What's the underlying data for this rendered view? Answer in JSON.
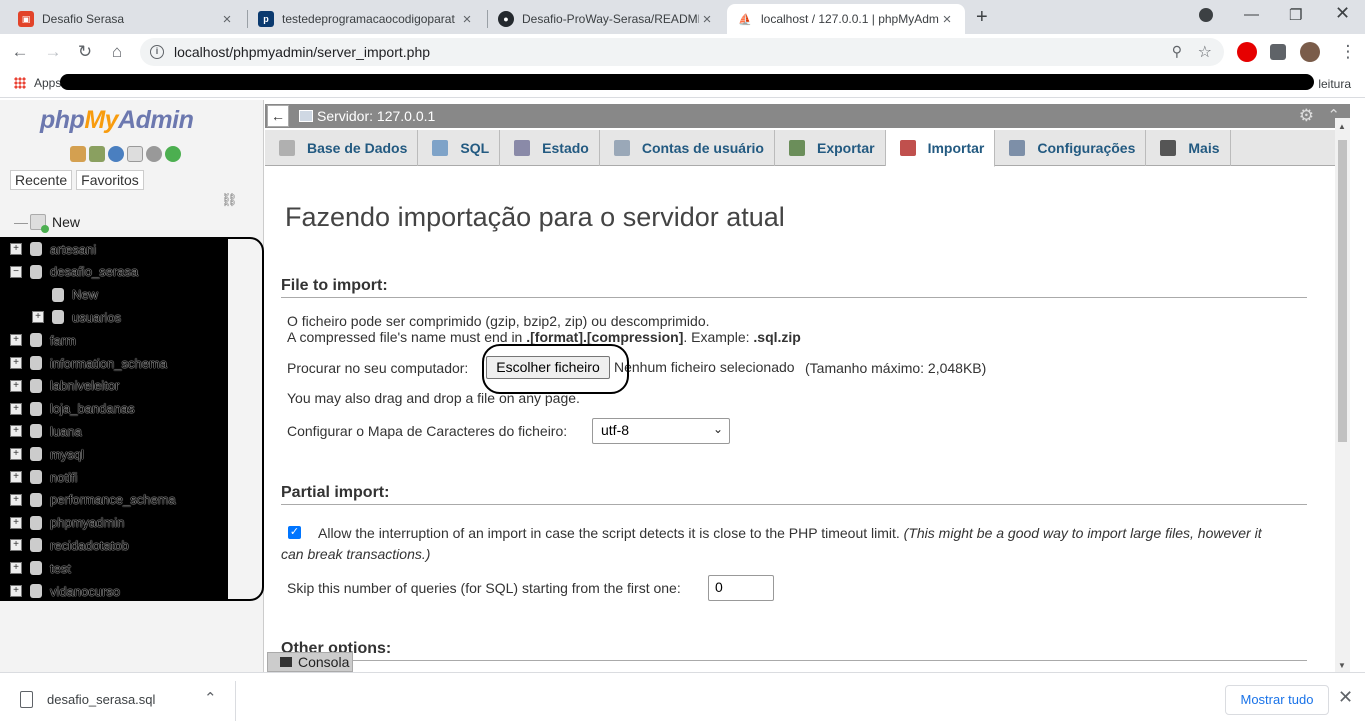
{
  "browser": {
    "tabs": [
      {
        "title": "Desafio Serasa",
        "icon": "gitlab-icon",
        "color": "#e24329"
      },
      {
        "title": "testedeprogramacaocodigoparat",
        "icon": "proway-icon",
        "color": "#0b3a6f"
      },
      {
        "title": "Desafio-ProWay-Serasa/README",
        "icon": "github-icon",
        "color": "#24292e"
      },
      {
        "title": "localhost / 127.0.0.1 | phpMyAdm",
        "icon": "pma-icon",
        "color": "#f89c0e"
      }
    ],
    "url": "localhost/phpmyadmin/server_import.php",
    "bookmarks": {
      "apps": "Apps",
      "reading": "leitura"
    }
  },
  "pma": {
    "logo": {
      "php": "php",
      "my": "My",
      "admin": "Admin"
    },
    "nav_tabs": [
      "Recente",
      "Favoritos"
    ],
    "new_label": "New",
    "databases": [
      {
        "name": "artesani",
        "expand": "+"
      },
      {
        "name": "desafio_serasa",
        "expand": "−"
      },
      {
        "name": "New",
        "child": true
      },
      {
        "name": "usuarios",
        "child": true,
        "expand": "+"
      },
      {
        "name": "farm",
        "expand": "+"
      },
      {
        "name": "information_schema",
        "expand": "+"
      },
      {
        "name": "labniveleitor",
        "expand": "+"
      },
      {
        "name": "loja_bandanas",
        "expand": "+"
      },
      {
        "name": "luana",
        "expand": "+"
      },
      {
        "name": "mysql",
        "expand": "+"
      },
      {
        "name": "notifi",
        "expand": "+"
      },
      {
        "name": "performance_schema",
        "expand": "+"
      },
      {
        "name": "phpmyadmin",
        "expand": "+"
      },
      {
        "name": "recidadotatob",
        "expand": "+"
      },
      {
        "name": "test",
        "expand": "+"
      },
      {
        "name": "vidanocurso",
        "expand": "+"
      }
    ],
    "server_label": "Servidor: 127.0.0.1",
    "menu": [
      {
        "label": "Base de Dados",
        "icon": "database-icon",
        "color": "#b0b0b0"
      },
      {
        "label": "SQL",
        "icon": "sql-icon",
        "color": "#7fa3c8"
      },
      {
        "label": "Estado",
        "icon": "status-icon",
        "color": "#8a8aa8"
      },
      {
        "label": "Contas de usuário",
        "icon": "users-icon",
        "color": "#9aa8b8"
      },
      {
        "label": "Exportar",
        "icon": "export-icon",
        "color": "#6b8e5a"
      },
      {
        "label": "Importar",
        "icon": "import-icon",
        "color": "#c0504d"
      },
      {
        "label": "Configurações",
        "icon": "wrench-icon",
        "color": "#7d8fa8"
      },
      {
        "label": "Mais",
        "icon": "chevron-down-icon",
        "color": "#555555"
      }
    ],
    "page_title": "Fazendo importação para o servidor atual",
    "file_import": {
      "heading": "File to import:",
      "line1": "O ficheiro pode ser comprimido (gzip, bzip2, zip) ou descomprimido.",
      "line2_a": "A compressed file's name must end in ",
      "line2_b": ".[format].[compression]",
      "line2_c": ". Example: ",
      "line2_d": ".sql.zip",
      "browse_label": "Procurar no seu computador:",
      "choose_button": "Escolher ficheiro",
      "no_file": "Nenhum ficheiro selecionado",
      "max_size": "(Tamanho máximo: 2,048KB)",
      "drag_drop": "You may also drag and drop a file on any page.",
      "charset_label": "Configurar o Mapa de Caracteres do ficheiro:",
      "charset_value": "utf-8"
    },
    "partial_import": {
      "heading": "Partial import:",
      "allow_label": "Allow the interruption of an import in case the script detects it is close to the PHP timeout limit.",
      "allow_note_1": "(This might be a good way to import large files, however it",
      "allow_note_2": "can break transactions.)",
      "skip_label": "Skip this number of queries (for SQL) starting from the first one:",
      "skip_value": "0"
    },
    "other_options_heading": "Other options:",
    "console_label": "Consola"
  },
  "downloads": {
    "file": "desafio_serasa.sql",
    "show_all": "Mostrar tudo"
  }
}
